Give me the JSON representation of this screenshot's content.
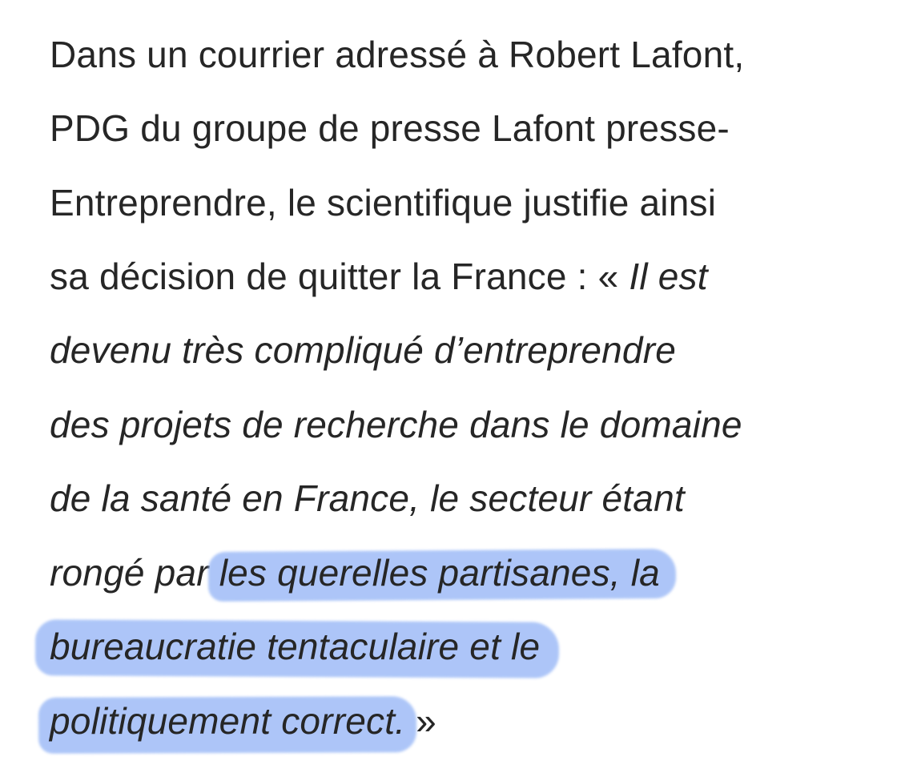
{
  "excerpt": {
    "lines": [
      "Dans un courrier adressé à Robert Lafont,",
      "PDG du groupe de presse Lafont presse-",
      "Entreprendre, le scientifique justifie ainsi",
      "sa décision de quitter la France : «",
      "Il est",
      "devenu très compliqué d’entreprendre",
      "des projets de recherche dans le domaine",
      "de la santé en France, le secteur étant",
      "rongé par",
      "les querelles partisanes, la",
      "bureaucratie tentaculaire et le",
      "politiquement correct.",
      "»"
    ],
    "highlight_color": "#9fbcf7",
    "text_color": "#262626"
  }
}
